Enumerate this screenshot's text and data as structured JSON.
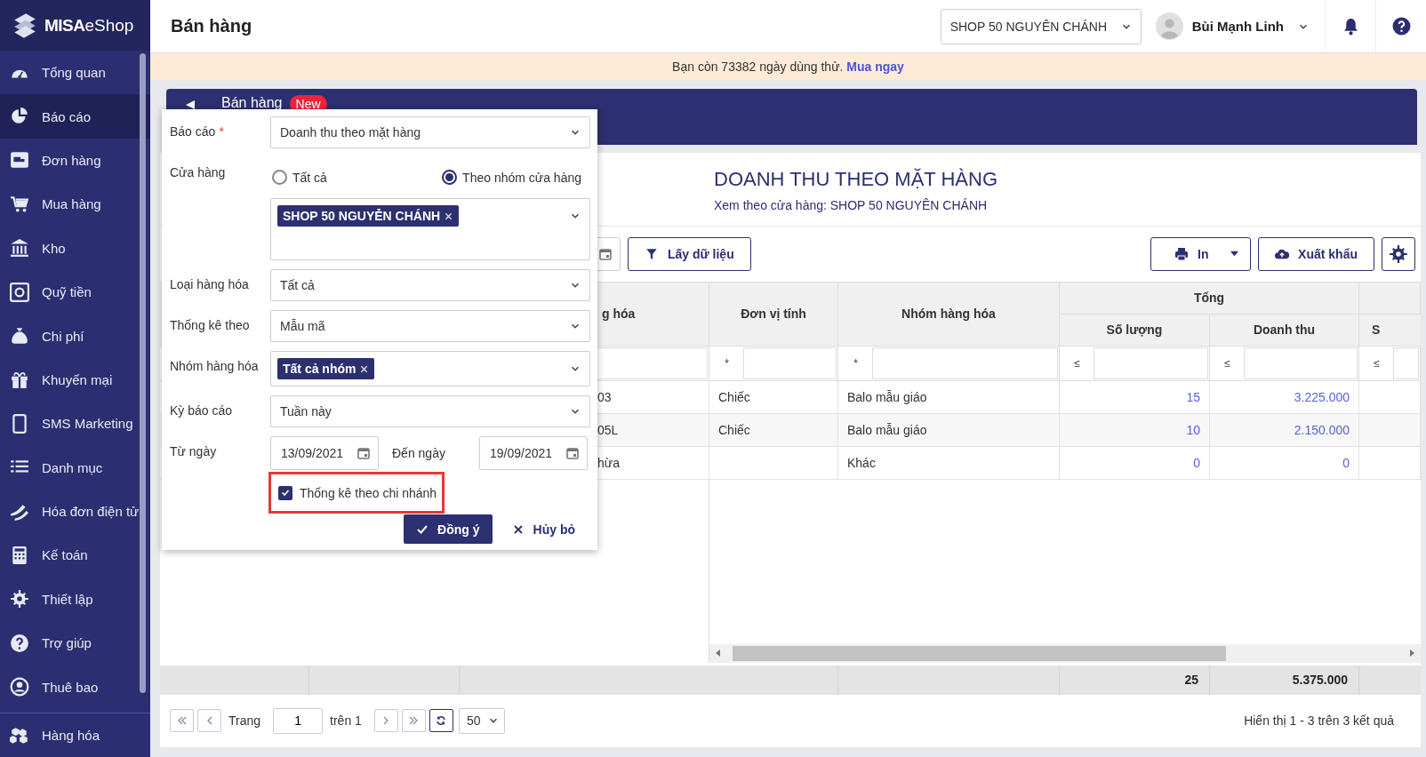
{
  "sidebar": {
    "logo": {
      "brand": "MISA",
      "suffix": "eShop"
    },
    "items": [
      {
        "label": "Tổng quan",
        "selected": false
      },
      {
        "label": "Báo cáo",
        "selected": true
      },
      {
        "label": "Đơn hàng",
        "selected": false
      },
      {
        "label": "Mua hàng",
        "selected": false
      },
      {
        "label": "Kho",
        "selected": false
      },
      {
        "label": "Quỹ tiền",
        "selected": false
      },
      {
        "label": "Chi phí",
        "selected": false
      },
      {
        "label": "Khuyến mại",
        "selected": false
      },
      {
        "label": "SMS Marketing",
        "selected": false
      },
      {
        "label": "Danh mục",
        "selected": false
      },
      {
        "label": "Hóa đơn điện tử",
        "selected": false
      },
      {
        "label": "Kế toán",
        "selected": false
      },
      {
        "label": "Thiết lập",
        "selected": false
      },
      {
        "label": "Trợ giúp",
        "selected": false
      },
      {
        "label": "Thuê bao",
        "selected": false
      },
      {
        "label": "Hàng hóa",
        "selected": false
      }
    ]
  },
  "header": {
    "title": "Bán hàng",
    "shop_select": "SHOP 50 NGUYÊN CHÁNH",
    "user_name": "Bùi Mạnh Linh"
  },
  "trial_notice": {
    "text": "Bạn còn 73382 ngày dùng thử.",
    "link": "Mua ngay"
  },
  "page_bar": {
    "title": "Bán hàng",
    "badge": "New"
  },
  "report": {
    "title": "DOANH THU THEO MẶT HÀNG",
    "subtitle": "Xem theo cửa hàng: SHOP 50 NGUYÊN CHÁNH",
    "toolbar": {
      "fetch_button": "Lấy dữ liệu",
      "print_button": "In",
      "export_button": "Xuất khẩu"
    },
    "table": {
      "columns": [
        {
          "label": "g hóa",
          "kind": "text"
        },
        {
          "label": "Đơn vị tính",
          "kind": "text",
          "operator": "*"
        },
        {
          "label": "Nhóm hàng hóa",
          "kind": "text",
          "operator": "*"
        },
        {
          "label": "Tổng",
          "kind": "group",
          "children": [
            {
              "label": "Số lượng",
              "kind": "number",
              "operator": "≤"
            },
            {
              "label": "Doanh thu",
              "kind": "number",
              "operator": "≤"
            }
          ]
        },
        {
          "kind": "group",
          "children": [
            {
              "label": "S",
              "kind": "number",
              "operator": "≤"
            }
          ]
        }
      ],
      "rows": [
        {
          "cells": [
            "03",
            "Chiếc",
            "Balo mẫu giáo",
            "15",
            "3.225.000"
          ]
        },
        {
          "cells": [
            "05L",
            "Chiếc",
            "Balo mẫu giáo",
            "10",
            "2.150.000"
          ]
        },
        {
          "cells": [
            "hừa",
            null,
            "Khác",
            "0",
            "0"
          ]
        }
      ],
      "totals": [
        "25",
        "5.375.000"
      ]
    },
    "pagination": {
      "page_label": "Trang",
      "page": "1",
      "of_label": "trên 1",
      "page_size": "50",
      "summary": "Hiển thị 1 - 3 trên 3 kết quả"
    }
  },
  "filter_popup": {
    "report": {
      "label": "Báo cáo",
      "required_mark": "*",
      "value": "Doanh thu theo mặt hàng"
    },
    "store": {
      "label": "Cửa hàng",
      "options": [
        {
          "label": "Tất cả",
          "selected": false
        },
        {
          "label": "Theo nhóm cửa hàng",
          "selected": true
        }
      ],
      "tags": [
        "SHOP 50 NGUYỄN CHÁNH"
      ]
    },
    "fields": [
      {
        "label": "Loại hàng hóa",
        "kind": "select",
        "value": "Tất cả"
      },
      {
        "label": "Thống kê theo",
        "kind": "select",
        "value": "Mẫu mã"
      },
      {
        "label": "Nhóm hàng hóa",
        "kind": "tags",
        "tags": [
          "Tất cả nhóm"
        ]
      },
      {
        "label": "Kỳ báo cáo",
        "kind": "select",
        "value": "Tuần này"
      }
    ],
    "date_range": {
      "from_label": "Từ ngày",
      "from": "13/09/2021",
      "to_label": "Đến ngày",
      "to": "19/09/2021"
    },
    "branch_option": {
      "label": "Thống kê theo chi nhánh",
      "checked": true,
      "highlighted": true
    },
    "buttons": [
      {
        "label": "Đồng ý",
        "kind": "primary"
      },
      {
        "label": "Hủy bỏ",
        "kind": "cancel"
      }
    ]
  }
}
